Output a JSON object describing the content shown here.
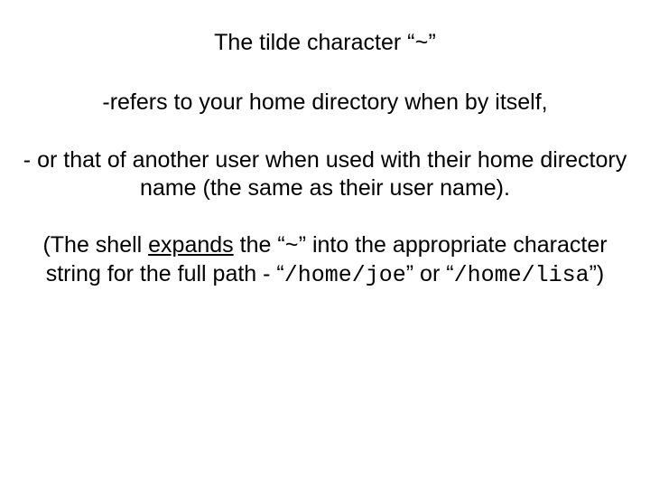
{
  "title": {
    "t1": "The tilde character “",
    "tilde": "~",
    "t2": "”"
  },
  "line1": "-refers to your home directory when by itself,",
  "line2": "- or that of another user when used with their home directory name (the same as their user name).",
  "para3": {
    "p1": "(The shell ",
    "expands": "expands",
    "p2": " the “",
    "tilde": "~",
    "p3": "” into the appropriate character string for the full path - “",
    "path1": "/home/joe",
    "p4": "” or “",
    "path2": "/home/lisa",
    "p5": "”)"
  }
}
